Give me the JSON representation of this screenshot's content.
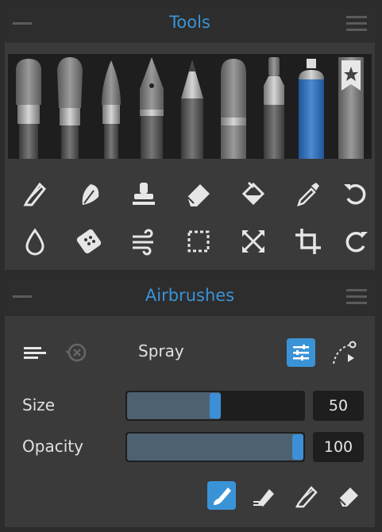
{
  "tools_panel": {
    "title": "Tools",
    "brushes": [
      "flat-brush-icon",
      "round-brush-icon",
      "fine-brush-icon",
      "ink-pen-icon",
      "pencil-icon",
      "marker-icon",
      "felt-pen-icon",
      "airbrush-icon",
      "favorites-icon"
    ],
    "selected_brush": "airbrush-icon",
    "tool_row1": [
      "smudge-pencil-icon",
      "blend-leaf-icon",
      "stamp-icon",
      "eraser-icon",
      "fill-bucket-icon",
      "eyedropper-icon",
      "undo-icon"
    ],
    "tool_row2": [
      "water-drop-icon",
      "texture-sponge-icon",
      "wind-icon",
      "marquee-select-icon",
      "transform-icon",
      "crop-icon",
      "redo-icon"
    ]
  },
  "brush_panel": {
    "title": "Airbrushes",
    "preset_name": "Spray",
    "size_label": "Size",
    "size_value": "50",
    "size_fraction": 0.5,
    "opacity_label": "Opacity",
    "opacity_value": "100",
    "opacity_fraction": 1.0
  },
  "colors": {
    "accent": "#3b93d7",
    "panel": "#3a3a3a",
    "titlebar": "#2d2d2d"
  }
}
